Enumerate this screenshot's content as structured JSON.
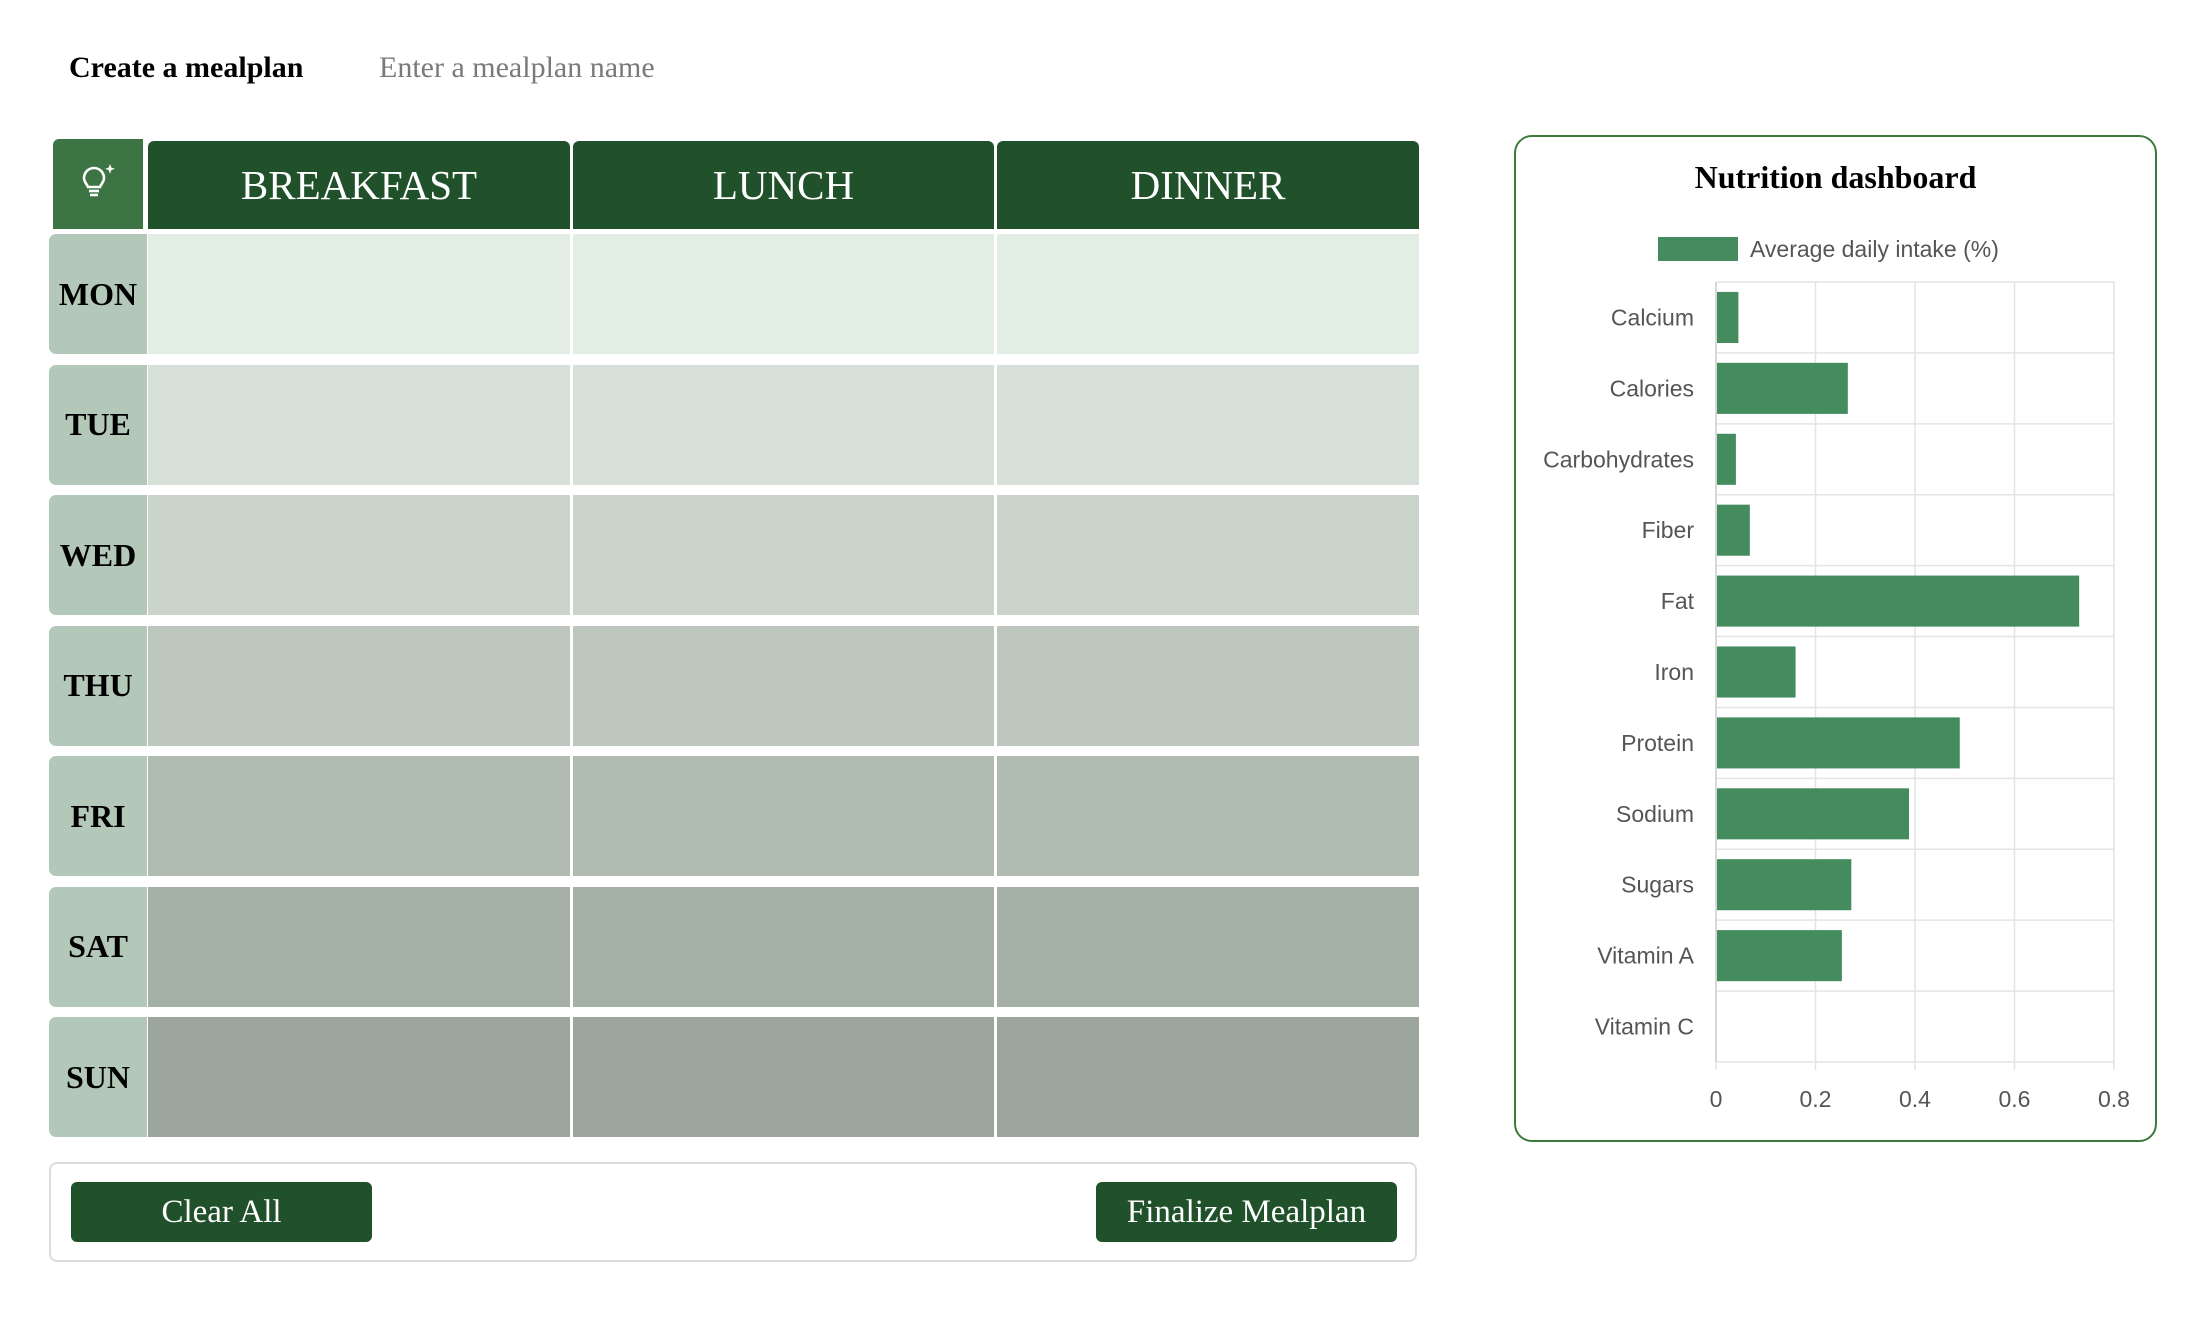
{
  "header": {
    "title": "Create a mealplan",
    "name_placeholder": "Enter a mealplan name",
    "name_value": ""
  },
  "planner": {
    "tip_icon": "lightbulb-sparkle-icon",
    "meals": [
      "BREAKFAST",
      "LUNCH",
      "DINNER"
    ],
    "days": [
      "MON",
      "TUE",
      "WED",
      "THU",
      "FRI",
      "SAT",
      "SUN"
    ],
    "row_colors": [
      "#e2ede4",
      "#d6e0d8",
      "#cad4cb",
      "#bdc7be",
      "#b0bcb2",
      "#a5b0a7",
      "#9ca69e"
    ],
    "header_color": "#21512b",
    "day_label_color": "#b4c8b9"
  },
  "actions": {
    "clear_label": "Clear All",
    "finalize_label": "Finalize Mealplan"
  },
  "dashboard": {
    "title": "Nutrition dashboard",
    "bar_color": "#448b5e"
  },
  "chart_data": {
    "type": "bar",
    "orientation": "horizontal",
    "categories": [
      "Calcium",
      "Calories",
      "Carbohydrates",
      "Fiber",
      "Fat",
      "Iron",
      "Protein",
      "Sodium",
      "Sugars",
      "Vitamin A",
      "Vitamin C"
    ],
    "series": [
      {
        "name": "Average daily intake (%)",
        "values": [
          0.045,
          0.265,
          0.04,
          0.068,
          0.73,
          0.16,
          0.49,
          0.388,
          0.272,
          0.253,
          0
        ]
      }
    ],
    "xlim": [
      0,
      0.8
    ],
    "xticks": [
      "0",
      "0.2",
      "0.4",
      "0.6",
      "0.8"
    ],
    "grid": true,
    "legend": "top"
  }
}
